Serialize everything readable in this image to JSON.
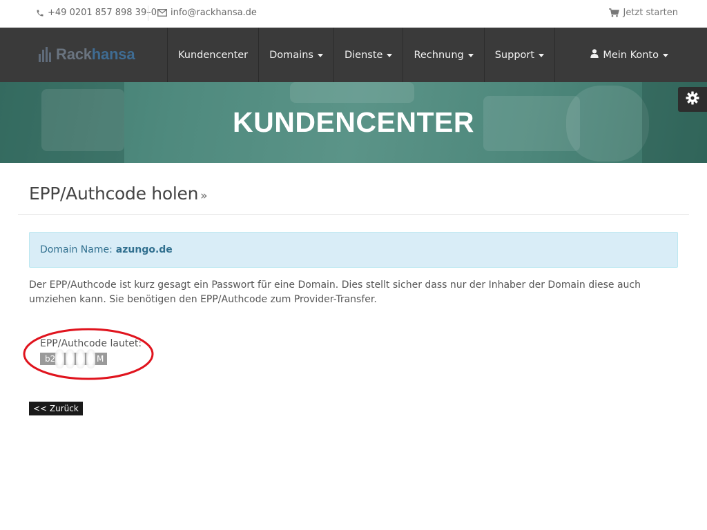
{
  "topbar": {
    "phone": "+49 0201 857 898 39–0",
    "email": "info@rackhansa.de",
    "cart_label": "Jetzt starten"
  },
  "nav": {
    "logo": {
      "part1": "Rack",
      "part2": "hansa"
    },
    "items": [
      {
        "label": "Kundencenter",
        "dropdown": false
      },
      {
        "label": "Domains",
        "dropdown": true
      },
      {
        "label": "Dienste",
        "dropdown": true
      },
      {
        "label": "Rechnung",
        "dropdown": true
      },
      {
        "label": "Support",
        "dropdown": true
      }
    ],
    "account_label": "Mein Konto"
  },
  "hero": {
    "title": "KUNDENCENTER"
  },
  "page": {
    "title": "EPP/Authcode holen",
    "title_suffix": "»",
    "alert_label": "Domain Name:",
    "domain": "azungo.de",
    "description": "Der EPP/Authcode ist kurz gesagt ein Passwort für eine Domain. Dies stellt sicher dass nur der Inhaber der Domain diese auch umziehen kann. Sie benötigen den EPP/Authcode zum Provider-Transfer.",
    "epp_label": "EPP/Authcode lautet:",
    "epp_code_visible": "b2",
    "epp_code_end": "M",
    "back_label": "<< Zurück"
  },
  "colors": {
    "nav_bg": "#3a3a3a",
    "hero_bg": "#4f8a7e",
    "alert_bg": "#d9edf7",
    "alert_text": "#31708f",
    "annotation_circle": "#e0141e"
  },
  "icons": {
    "phone": "phone-icon",
    "mail": "envelope-icon",
    "cart": "cart-icon",
    "account": "user-icon",
    "settings": "gear-icon"
  }
}
